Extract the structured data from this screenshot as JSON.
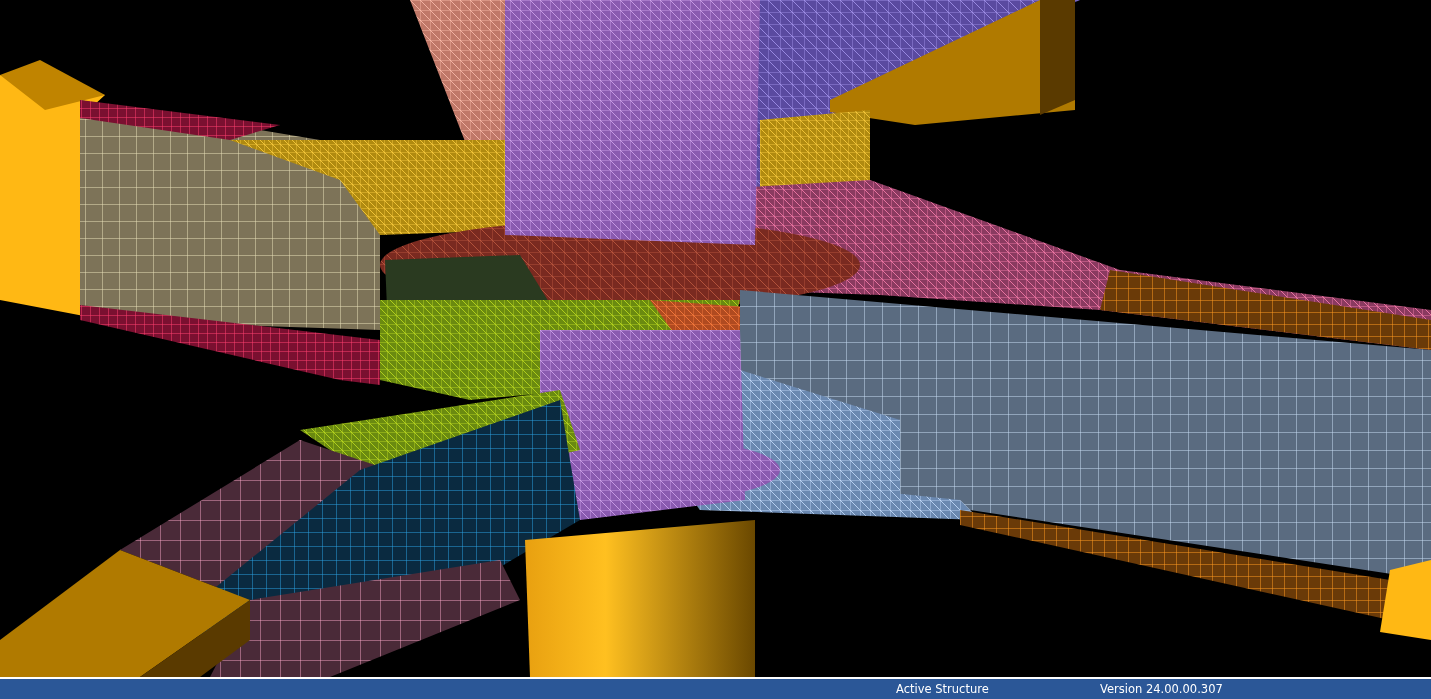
{
  "status_bar": {
    "items": [
      {
        "kind": "mode",
        "text": "Active Structure"
      },
      {
        "kind": "version",
        "text": "Version 24.00.00.307"
      }
    ]
  }
}
